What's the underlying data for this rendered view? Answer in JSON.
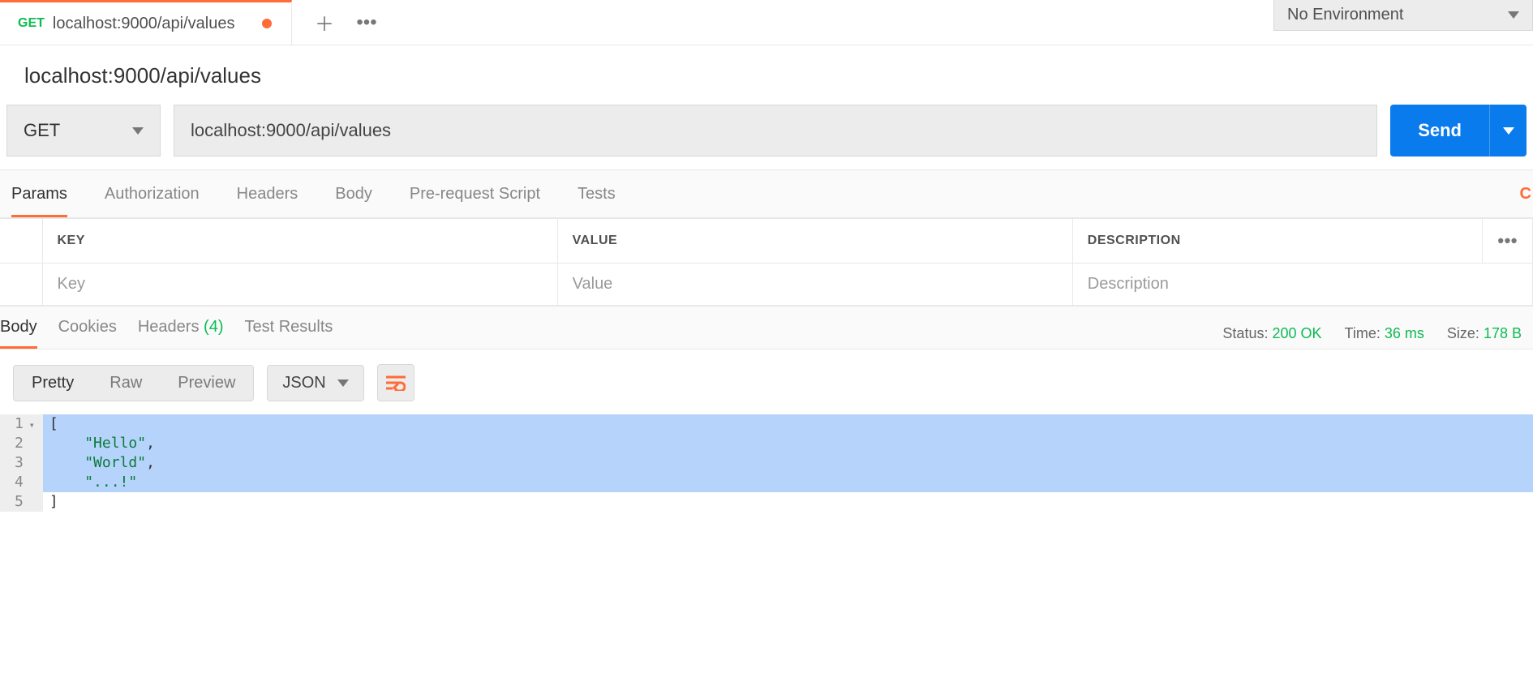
{
  "env": {
    "selected_label": "No Environment"
  },
  "tab": {
    "method": "GET",
    "title": "localhost:9000/api/values",
    "dirty": true
  },
  "request": {
    "title": "localhost:9000/api/values",
    "method": "GET",
    "url": "localhost:9000/api/values",
    "send_label": "Send"
  },
  "request_tabs": {
    "items": [
      "Params",
      "Authorization",
      "Headers",
      "Body",
      "Pre-request Script",
      "Tests"
    ],
    "active_index": 0
  },
  "params_table": {
    "headers": {
      "key": "KEY",
      "value": "VALUE",
      "description": "DESCRIPTION"
    },
    "placeholders": {
      "key": "Key",
      "value": "Value",
      "description": "Description"
    }
  },
  "response_tabs": {
    "items": [
      {
        "label": "Body"
      },
      {
        "label": "Cookies"
      },
      {
        "label": "Headers",
        "count": "(4)"
      },
      {
        "label": "Test Results"
      }
    ],
    "active_index": 0
  },
  "response_meta": {
    "status_label": "Status:",
    "status_value": "200 OK",
    "time_label": "Time:",
    "time_value": "36 ms",
    "size_label": "Size:",
    "size_value": "178 B"
  },
  "view": {
    "modes": [
      "Pretty",
      "Raw",
      "Preview"
    ],
    "active_mode_index": 0,
    "format": "JSON"
  },
  "code": {
    "lines": [
      {
        "n": 1,
        "foldable": true,
        "selected": true,
        "tokens": [
          {
            "t": "[",
            "c": "punc"
          }
        ]
      },
      {
        "n": 2,
        "foldable": false,
        "selected": true,
        "tokens": [
          {
            "t": "    ",
            "c": "punc"
          },
          {
            "t": "\"Hello\"",
            "c": "str"
          },
          {
            "t": ",",
            "c": "punc"
          }
        ]
      },
      {
        "n": 3,
        "foldable": false,
        "selected": true,
        "tokens": [
          {
            "t": "    ",
            "c": "punc"
          },
          {
            "t": "\"World\"",
            "c": "str"
          },
          {
            "t": ",",
            "c": "punc"
          }
        ]
      },
      {
        "n": 4,
        "foldable": false,
        "selected": true,
        "tokens": [
          {
            "t": "    ",
            "c": "punc"
          },
          {
            "t": "\"...!\"",
            "c": "str"
          }
        ]
      },
      {
        "n": 5,
        "foldable": false,
        "selected": false,
        "tokens": [
          {
            "t": "]",
            "c": "punc"
          }
        ]
      }
    ]
  }
}
